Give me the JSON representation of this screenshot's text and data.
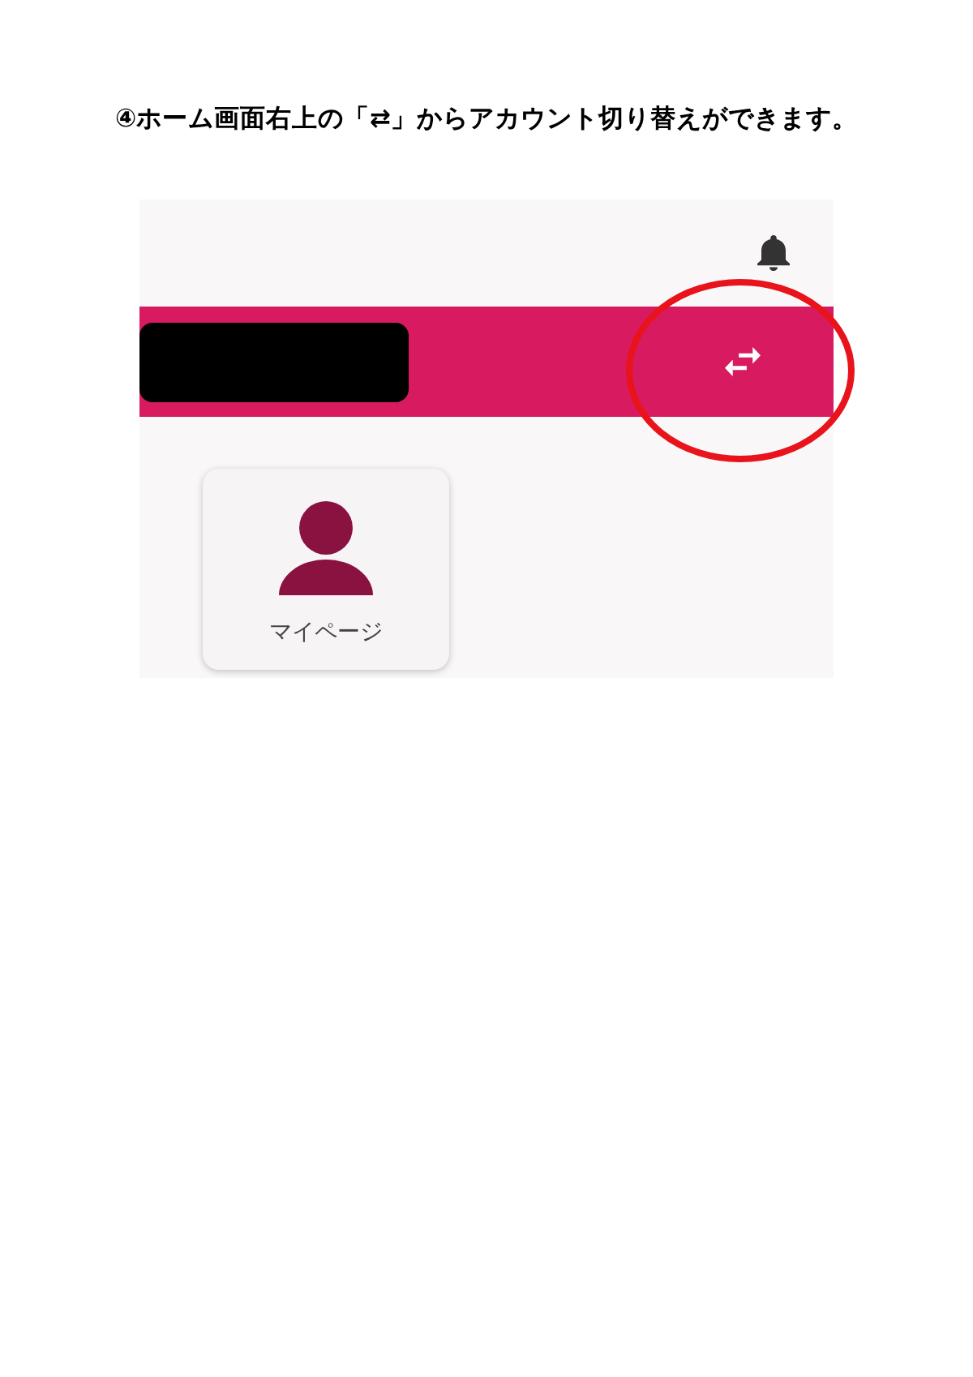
{
  "heading": "④ホーム画面右上の「⇄」からアカウント切り替えができます。",
  "app": {
    "tiles": [
      {
        "label": "マイページ"
      }
    ]
  }
}
